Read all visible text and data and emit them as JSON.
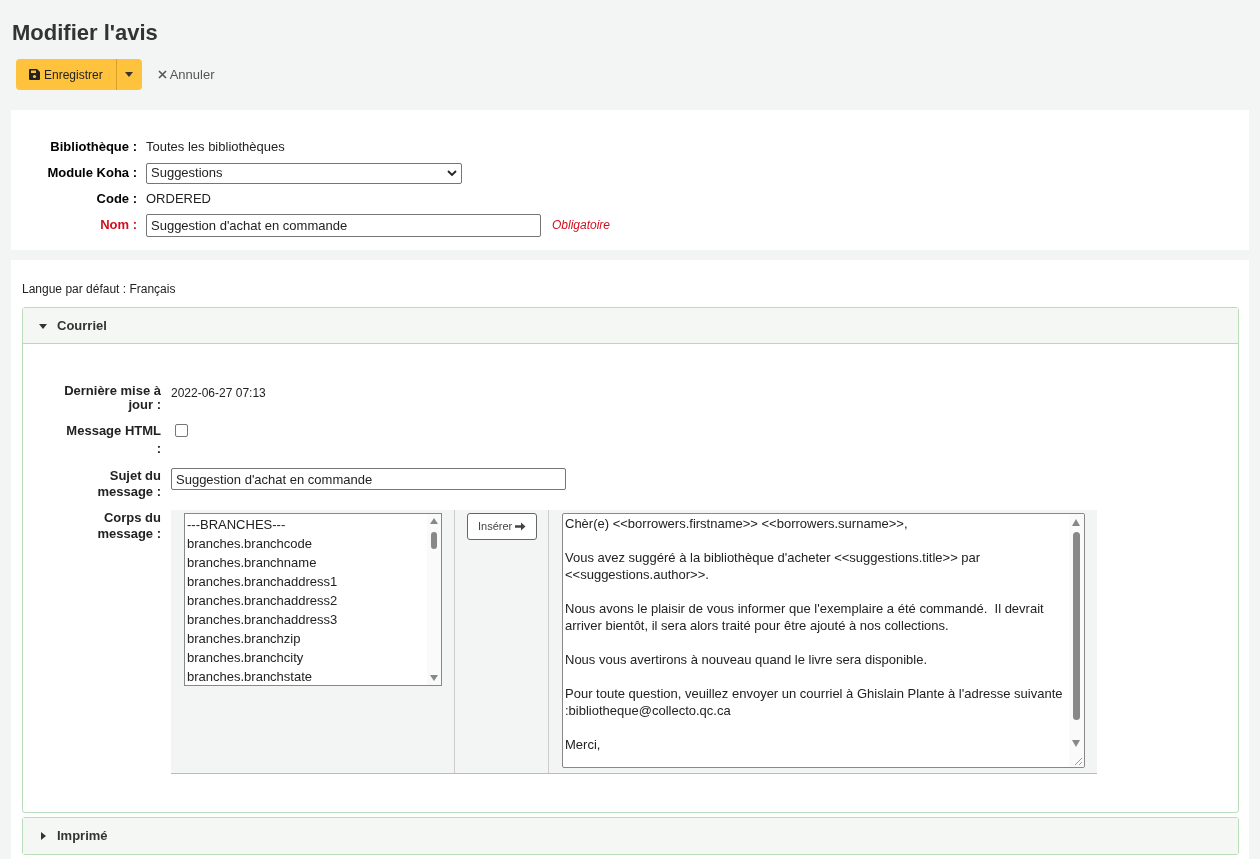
{
  "title": "Modifier l'avis",
  "toolbar": {
    "save": "Enregistrer",
    "cancel": "Annuler"
  },
  "notice": {
    "fields": [
      {
        "label": "Bibliothèque :",
        "kind": "text",
        "value": "Toutes les bibliothèques",
        "required": false
      },
      {
        "label": "Module Koha :",
        "kind": "select",
        "value": "Suggestions",
        "required": false
      },
      {
        "label": "Code :",
        "kind": "text",
        "value": "ORDERED",
        "required": false
      },
      {
        "label": "Nom :",
        "kind": "input",
        "value": "Suggestion d'achat en commande",
        "required": true,
        "hint": "Obligatoire"
      }
    ]
  },
  "default_language": {
    "label": "Langue par défaut :",
    "value": "Français"
  },
  "sections": [
    {
      "title": "Courriel",
      "expanded": true,
      "last_update": {
        "label": "Dernière mise à jour :",
        "value": "2022-06-27 07:13"
      },
      "html": {
        "label": "Message HTML :",
        "checked": false
      },
      "subject": {
        "label": "Sujet du message :",
        "value": "Suggestion d'achat en commande"
      },
      "body": {
        "label": "Corps du message :",
        "fields": [
          "---BRANCHES---",
          "branches.branchcode",
          "branches.branchname",
          "branches.branchaddress1",
          "branches.branchaddress2",
          "branches.branchaddress3",
          "branches.branchzip",
          "branches.branchcity",
          "branches.branchstate"
        ],
        "insert": "Insérer",
        "paragraphs": [
          "Chèr(e) <<borrowers.firstname>> <<borrowers.surname>>,",
          "Vous avez suggéré à la bibliothèque d'acheter <<suggestions.title>> par <<suggestions.author>>.",
          "Nous avons le plaisir de vous informer que l'exemplaire a été commandé.  Il devrait arriver bientôt, il sera alors traité pour être ajouté à nos collections.",
          "Nous vous avertirons à nouveau quand le livre sera disponible.",
          "Pour toute question, veuillez envoyer un courriel à Ghislain Plante à l'adresse suivante :bibliotheque@collecto.qc.ca",
          "Merci,"
        ]
      }
    },
    {
      "title": "Imprimé",
      "expanded": false
    }
  ]
}
